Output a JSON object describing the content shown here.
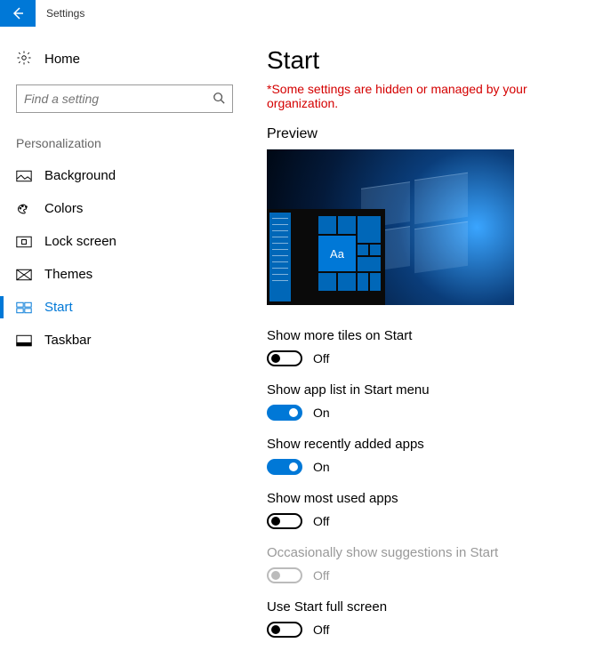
{
  "window": {
    "title": "Settings"
  },
  "sidebar": {
    "home_label": "Home",
    "search_placeholder": "Find a setting",
    "section_label": "Personalization",
    "items": [
      {
        "label": "Background",
        "active": false
      },
      {
        "label": "Colors",
        "active": false
      },
      {
        "label": "Lock screen",
        "active": false
      },
      {
        "label": "Themes",
        "active": false
      },
      {
        "label": "Start",
        "active": true
      },
      {
        "label": "Taskbar",
        "active": false
      }
    ]
  },
  "page": {
    "title": "Start",
    "org_warning": "*Some settings are hidden or managed by your organization.",
    "preview_label": "Preview",
    "preview_tile_text": "Aa",
    "settings": [
      {
        "label": "Show more tiles on Start",
        "state": "Off",
        "on": false,
        "disabled": false
      },
      {
        "label": "Show app list in Start menu",
        "state": "On",
        "on": true,
        "disabled": false
      },
      {
        "label": "Show recently added apps",
        "state": "On",
        "on": true,
        "disabled": false
      },
      {
        "label": "Show most used apps",
        "state": "Off",
        "on": false,
        "disabled": false
      },
      {
        "label": "Occasionally show suggestions in Start",
        "state": "Off",
        "on": false,
        "disabled": true
      },
      {
        "label": "Use Start full screen",
        "state": "Off",
        "on": false,
        "disabled": false
      }
    ]
  }
}
